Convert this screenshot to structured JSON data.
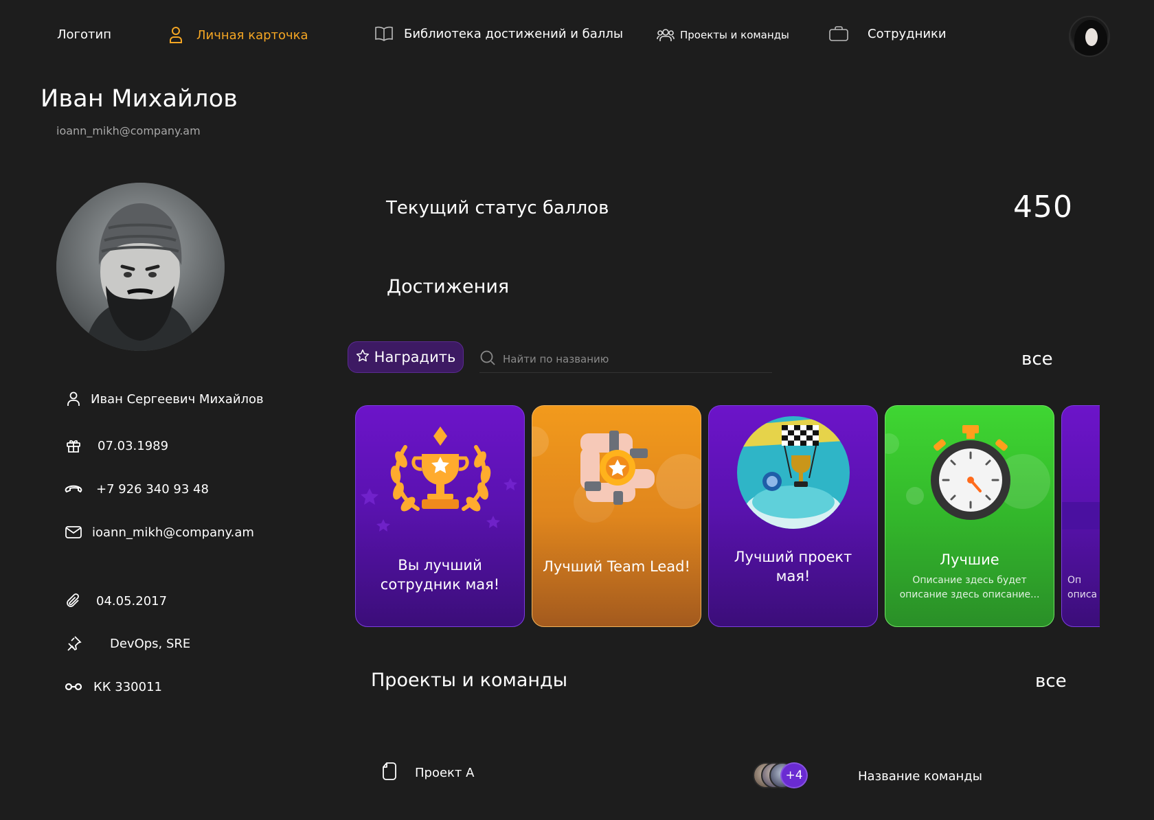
{
  "nav": {
    "logo": "Логотип",
    "items": [
      {
        "label": "Личная карточка",
        "icon": "user-icon",
        "active": true
      },
      {
        "label": "Библиотека достижений и баллы",
        "icon": "book-icon",
        "active": false
      },
      {
        "label": "Проекты и команды",
        "icon": "users-icon",
        "active": false
      },
      {
        "label": "Сотрудники",
        "icon": "briefcase-icon",
        "active": false
      }
    ],
    "avatar_icon": "user-avatar"
  },
  "profile": {
    "name": "Иван Михайлов",
    "email": "ioann_mikh@company.am",
    "details": [
      {
        "icon": "user-icon",
        "value": "Иван Сергеевич Михайлов"
      },
      {
        "icon": "gift-icon",
        "value": "07.03.1989"
      },
      {
        "icon": "phone-icon",
        "value": "+7 926 340 93 48"
      },
      {
        "icon": "mail-icon",
        "value": "ioann_mikh@company.am"
      },
      {
        "icon": "paperclip-icon",
        "value": "04.05.2017"
      },
      {
        "icon": "pin-icon",
        "value": "DevOps, SRE"
      },
      {
        "icon": "glasses-icon",
        "value": "КК 330011"
      }
    ]
  },
  "points": {
    "label": "Текущий статус баллов",
    "value": "450"
  },
  "achievements": {
    "title": "Достижения",
    "award_button": "Наградить",
    "search_placeholder": "Найти по названию",
    "all_link": "все",
    "cards": [
      {
        "title": "Вы лучший сотрудник мая!",
        "color": "purple",
        "icon": "trophy-laurel-icon"
      },
      {
        "title": "Лучший Team Lead!",
        "color": "orange",
        "icon": "team-hands-icon"
      },
      {
        "title": "Лучший проект мая!",
        "color": "purple",
        "icon": "finish-trophy-icon"
      },
      {
        "title": "Лучшие",
        "description": "Описание здесь будет описание здесь описание...",
        "color": "green",
        "icon": "stopwatch-icon"
      },
      {
        "title": "",
        "description": "Оп описа",
        "color": "purple",
        "icon": ""
      }
    ]
  },
  "projects": {
    "title": "Проекты и команды",
    "all_link": "все",
    "items": [
      {
        "name": "Проект А",
        "team_extra": "+4",
        "team_name": "Название команды"
      }
    ]
  },
  "colors": {
    "background": "#1d1d1d",
    "accent": "#f5a623",
    "purple": "#6c14c9",
    "orange": "#f29a1c",
    "green": "#3fd632"
  }
}
